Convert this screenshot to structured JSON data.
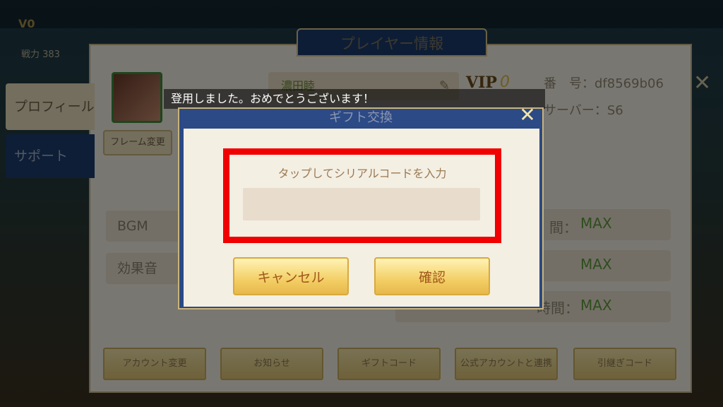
{
  "background": {
    "top_resources": [
      "",
      "",
      "",
      "",
      "",
      ""
    ],
    "vip_side": "V0",
    "power_text": "戦力 383",
    "side_text": "",
    "panel": {
      "title": "プレイヤー情報",
      "tabs": [
        {
          "label": "プロフィール"
        },
        {
          "label": "サポート"
        }
      ],
      "frame_change_label": "フレーム変更",
      "name": "濃田睦",
      "vip_label": "VIP",
      "vip_level": "0",
      "number_label": "番　号：df8569b06",
      "server_label": "サーバー：S6",
      "settings": [
        {
          "label": "BGM"
        },
        {
          "label": "効果音"
        }
      ],
      "stats": [
        {
          "label": "間：",
          "value": "MAX"
        },
        {
          "label": "",
          "value": "MAX"
        },
        {
          "label": "時間：",
          "value": "MAX"
        }
      ],
      "bottom_buttons": [
        {
          "label": "アカウント変更"
        },
        {
          "label": "お知らせ"
        },
        {
          "label": "ギフトコード"
        },
        {
          "label": "公式アカウントと連携"
        },
        {
          "label": "引継ぎコード"
        }
      ]
    }
  },
  "toast": {
    "message": "登用しました。おめでとうございます！"
  },
  "dialog": {
    "title": "ギフト交換",
    "serial_label": "タップしてシリアルコードを入力",
    "serial_value": "",
    "serial_placeholder": "",
    "cancel_label": "キャンセル",
    "confirm_label": "確認"
  },
  "colors": {
    "dialog_frame": "#2b4a86",
    "highlight": "#f00000",
    "button_gold": "#f3cf66",
    "button_text": "#a0571a",
    "stat_value": "#5e9a3c"
  }
}
